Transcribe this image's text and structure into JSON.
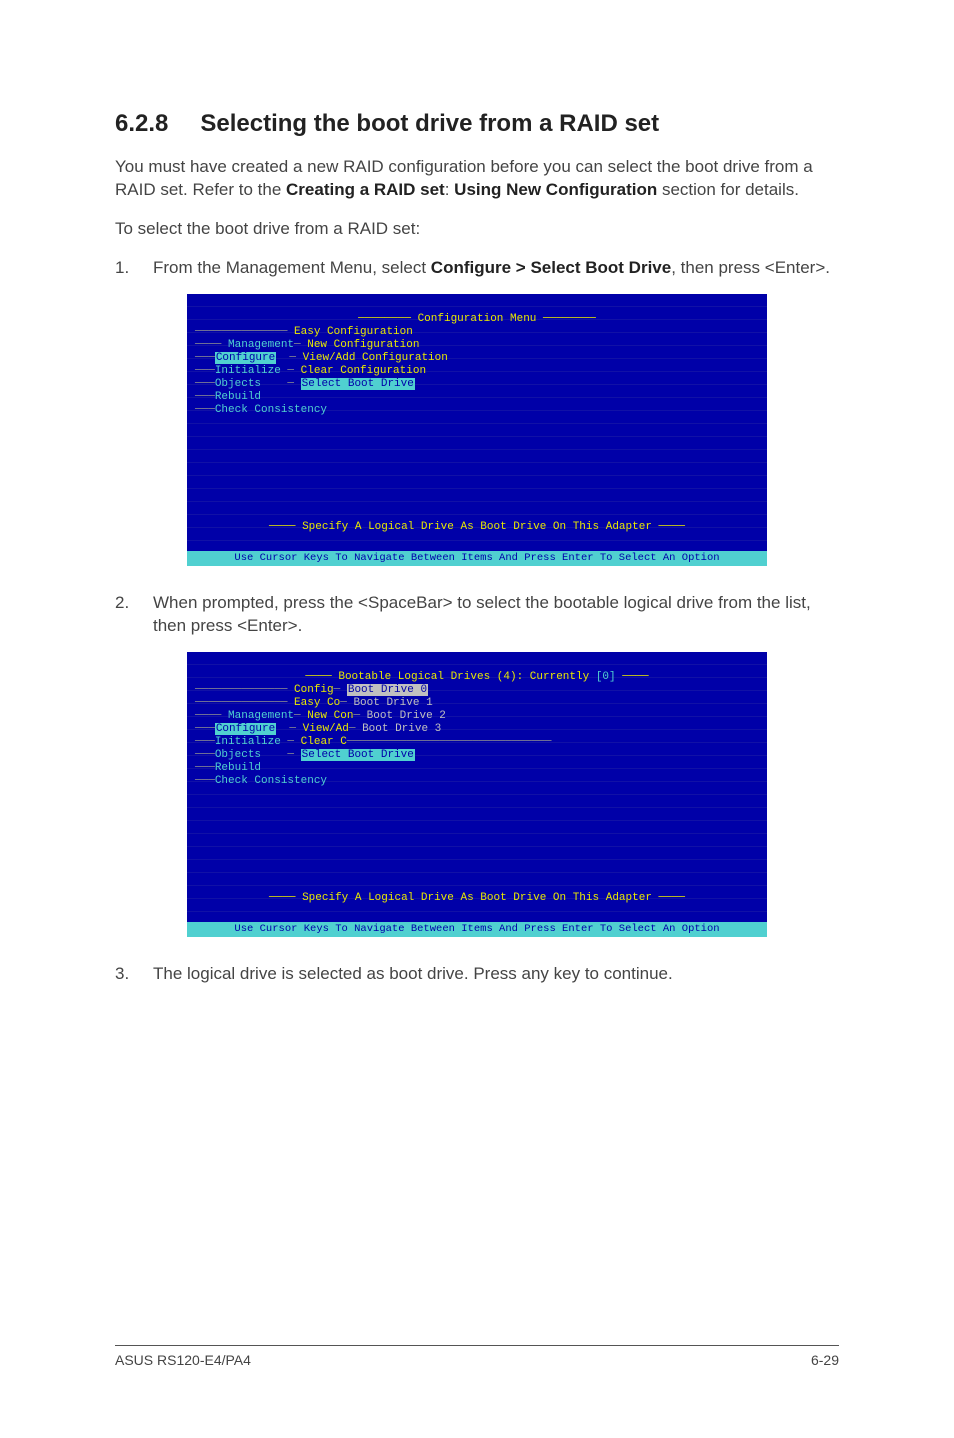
{
  "section": {
    "number": "6.2.8",
    "title": "Selecting the boot drive from a RAID set"
  },
  "intro": {
    "p1_a": "You must have created a new RAID configuration before you can select the boot drive from a RAID set. Refer to the ",
    "p1_bold1": "Creating a RAID set",
    "p1_colon": ": ",
    "p1_bold2": "Using New Configuration",
    "p1_b": " section for details.",
    "p2": "To select the boot drive from a RAID set:"
  },
  "steps": {
    "s1_num": "1.",
    "s1_a": "From the Management Menu, select ",
    "s1_bold": "Configure > Select Boot Drive",
    "s1_b": ", then press <Enter>.",
    "s2_num": "2.",
    "s2": "When prompted, press the <SpaceBar> to select the bootable logical drive from the list, then press <Enter>.",
    "s3_num": "3.",
    "s3": "The logical drive is selected as boot drive. Press any key to continue."
  },
  "term1": {
    "title": "Configuration Menu",
    "menu_mgmt": "Management",
    "menu_conf": "Configure",
    "menu_init": "Initialize",
    "menu_obj": "Objects",
    "menu_reb": "Rebuild",
    "menu_chk": "Check Consistency",
    "cfg_easy": "Easy Configuration",
    "cfg_new": "New Configuration",
    "cfg_view": "View/Add Configuration",
    "cfg_clear": "Clear Configuration",
    "cfg_boot": "Select Boot Drive",
    "message": "Specify A Logical Drive As Boot Drive On This Adapter",
    "footer": "Use Cursor Keys To Navigate Between Items And Press Enter To Select An Option"
  },
  "term2": {
    "title_a": "Bootable Logical Drives (4): Currently ",
    "title_b": "[0]",
    "menu_mgmt": "Management",
    "menu_conf": "Configure",
    "menu_init": "Initialize",
    "menu_obj": "Objects",
    "menu_reb": "Rebuild",
    "menu_chk": "Check Consistency",
    "cfg_pref": "Config",
    "cfg_easy": "Easy Co",
    "cfg_new": "New Con",
    "cfg_view": "View/Ad",
    "cfg_clear": "Clear C",
    "cfg_boot": "Select Boot Drive",
    "bd0": "Boot Drive 0",
    "bd1": "Boot Drive 1",
    "bd2": "Boot Drive 2",
    "bd3": "Boot Drive 3",
    "message": "Specify A Logical Drive As Boot Drive On This Adapter",
    "footer": "Use Cursor Keys To Navigate Between Items And Press Enter To Select An Option"
  },
  "footer": {
    "left": "ASUS RS120-E4/PA4",
    "right": "6-29"
  }
}
